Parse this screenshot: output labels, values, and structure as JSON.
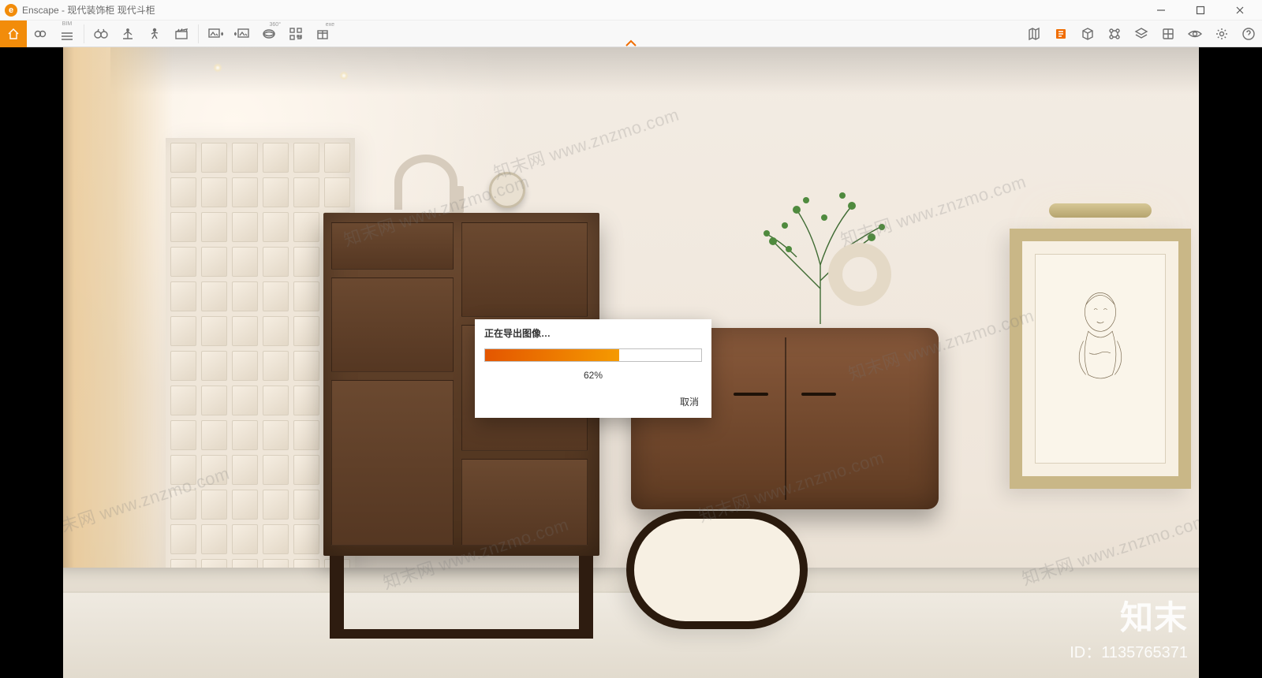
{
  "title": "Enscape - 现代装饰柜 现代斗柜",
  "toolbar_left": [
    {
      "name": "home-icon",
      "active": true
    },
    {
      "name": "link-icon"
    },
    {
      "name": "bim-icon",
      "label": "BIM"
    },
    {
      "name": "binoculars-icon"
    },
    {
      "name": "floor-icon"
    },
    {
      "name": "walk-icon"
    },
    {
      "name": "clapboard-icon"
    },
    {
      "name": "export-image-left-icon"
    },
    {
      "name": "export-image-right-icon"
    },
    {
      "name": "panorama-icon"
    },
    {
      "name": "qr-icon"
    },
    {
      "name": "package-icon"
    }
  ],
  "toolbar_right": [
    {
      "name": "map-icon"
    },
    {
      "name": "info-panel-icon",
      "accent": true
    },
    {
      "name": "cube-icon"
    },
    {
      "name": "assets-icon"
    },
    {
      "name": "layers-icon"
    },
    {
      "name": "materials-icon"
    },
    {
      "name": "visibility-icon"
    },
    {
      "name": "settings-icon"
    },
    {
      "name": "help-icon"
    }
  ],
  "dialog": {
    "title": "正在导出图像…",
    "percent_text": "62%",
    "percent_value": 62,
    "cancel": "取消"
  },
  "watermark": {
    "domain_text": "知末网 www.znzmo.com",
    "id_label": "ID：",
    "id_value": "1135765371",
    "logo_text": "知末"
  }
}
